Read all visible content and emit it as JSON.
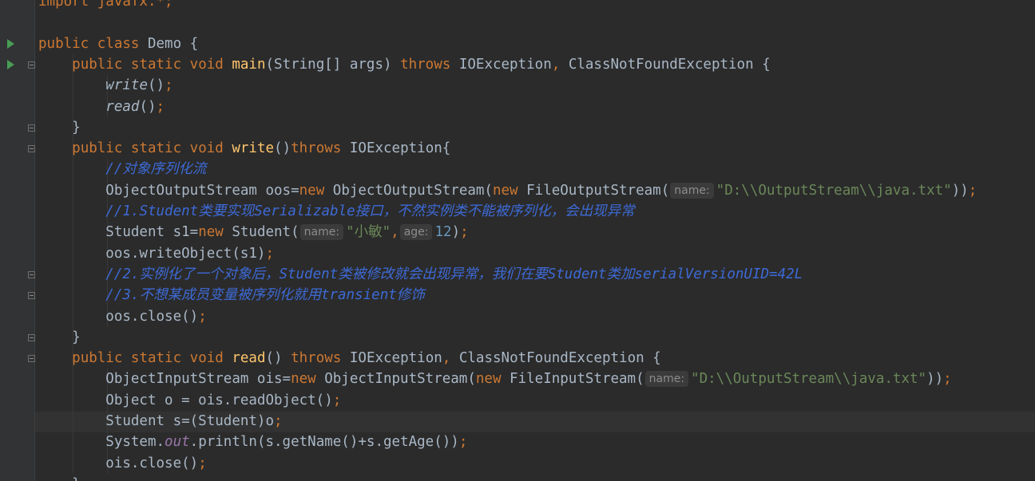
{
  "code_lines": [
    {
      "tokens": [
        {
          "t": "import javafx.*;",
          "c": "kw"
        }
      ]
    },
    {
      "tokens": []
    },
    {
      "tokens": [
        {
          "t": "public class ",
          "c": "kw"
        },
        {
          "t": "Demo {"
        }
      ]
    },
    {
      "tokens": [
        {
          "t": "    "
        },
        {
          "t": "public static void ",
          "c": "kw"
        },
        {
          "t": "main",
          "c": "fn"
        },
        {
          "t": "(String[] args) "
        },
        {
          "t": "throws ",
          "c": "kw"
        },
        {
          "t": "IOException"
        },
        {
          "t": ", ",
          "c": "punc"
        },
        {
          "t": "ClassNotFoundException {"
        }
      ]
    },
    {
      "tokens": [
        {
          "t": "        "
        },
        {
          "t": "write",
          "c": "it"
        },
        {
          "t": "()"
        },
        {
          "t": ";",
          "c": "punc"
        }
      ]
    },
    {
      "tokens": [
        {
          "t": "        "
        },
        {
          "t": "read",
          "c": "it"
        },
        {
          "t": "()"
        },
        {
          "t": ";",
          "c": "punc"
        }
      ]
    },
    {
      "tokens": [
        {
          "t": "    }"
        }
      ]
    },
    {
      "tokens": [
        {
          "t": "    "
        },
        {
          "t": "public static void ",
          "c": "kw"
        },
        {
          "t": "write",
          "c": "fn"
        },
        {
          "t": "()"
        },
        {
          "t": "throws ",
          "c": "kw"
        },
        {
          "t": "IOException{"
        }
      ]
    },
    {
      "tokens": [
        {
          "t": "        "
        },
        {
          "t": "//对象序列化流",
          "c": "cmt"
        }
      ]
    },
    {
      "tokens": [
        {
          "t": "        ObjectOutputStream oos="
        },
        {
          "t": "new ",
          "c": "kw"
        },
        {
          "t": "ObjectOutputStream("
        },
        {
          "t": "new ",
          "c": "kw"
        },
        {
          "t": "FileOutputStream("
        },
        {
          "t": "name:",
          "c": "hint"
        },
        {
          "t": "\"D:\\\\OutputStream\\\\java.txt\"",
          "c": "str"
        },
        {
          "t": "))"
        },
        {
          "t": ";",
          "c": "punc"
        }
      ]
    },
    {
      "tokens": [
        {
          "t": "        "
        },
        {
          "t": "//1.Student类要实现Serializable接口，不然实例类不能被序列化，会出现异常",
          "c": "cmt"
        }
      ]
    },
    {
      "tokens": [
        {
          "t": "        Student s1="
        },
        {
          "t": "new ",
          "c": "kw"
        },
        {
          "t": "Student("
        },
        {
          "t": "name:",
          "c": "hint"
        },
        {
          "t": "\"小敏\"",
          "c": "str"
        },
        {
          "t": ",",
          "c": "punc"
        },
        {
          "t": "age:",
          "c": "hint"
        },
        {
          "t": "12",
          "c": "num"
        },
        {
          "t": ")"
        },
        {
          "t": ";",
          "c": "punc"
        }
      ]
    },
    {
      "tokens": [
        {
          "t": "        oos.writeObject(s1)"
        },
        {
          "t": ";",
          "c": "punc"
        }
      ]
    },
    {
      "tokens": [
        {
          "t": "        "
        },
        {
          "t": "//2.实例化了一个对象后，Student类被修改就会出现异常，我们在要Student类加serialVersionUID=42L",
          "c": "cmt"
        }
      ]
    },
    {
      "tokens": [
        {
          "t": "        "
        },
        {
          "t": "//3.不想某成员变量被序列化就用transient修饰",
          "c": "cmt"
        }
      ]
    },
    {
      "tokens": [
        {
          "t": "        oos.close()"
        },
        {
          "t": ";",
          "c": "punc"
        }
      ]
    },
    {
      "tokens": [
        {
          "t": "    }"
        }
      ]
    },
    {
      "tokens": [
        {
          "t": "    "
        },
        {
          "t": "public static void ",
          "c": "kw"
        },
        {
          "t": "read",
          "c": "fn"
        },
        {
          "t": "() "
        },
        {
          "t": "throws ",
          "c": "kw"
        },
        {
          "t": "IOException"
        },
        {
          "t": ", ",
          "c": "punc"
        },
        {
          "t": "ClassNotFoundException {"
        }
      ]
    },
    {
      "tokens": [
        {
          "t": "        ObjectInputStream ois="
        },
        {
          "t": "new ",
          "c": "kw"
        },
        {
          "t": "ObjectInputStream("
        },
        {
          "t": "new ",
          "c": "kw"
        },
        {
          "t": "FileInputStream("
        },
        {
          "t": "name:",
          "c": "hint"
        },
        {
          "t": "\"D:\\\\OutputStream\\\\java.txt\"",
          "c": "str"
        },
        {
          "t": "))"
        },
        {
          "t": ";",
          "c": "punc"
        }
      ]
    },
    {
      "tokens": [
        {
          "t": "        Object o = ois.readObject()"
        },
        {
          "t": ";",
          "c": "punc"
        }
      ]
    },
    {
      "tokens": [
        {
          "t": "        Student s=(Student)o"
        },
        {
          "t": ";",
          "c": "punc"
        }
      ]
    },
    {
      "tokens": [
        {
          "t": "        System."
        },
        {
          "t": "out",
          "c": "fld"
        },
        {
          "t": ".println(s.getName()+s.getAge())"
        },
        {
          "t": ";",
          "c": "punc"
        }
      ]
    },
    {
      "tokens": [
        {
          "t": "        ois.close()"
        },
        {
          "t": ";",
          "c": "punc"
        }
      ]
    },
    {
      "tokens": [
        {
          "t": "    }"
        }
      ]
    }
  ],
  "current_line_index": 20,
  "run_icon_lines": [
    2,
    3
  ],
  "fold_icon_lines": [
    3,
    6,
    7,
    13,
    14,
    16,
    17,
    23
  ],
  "icons": {
    "run": "run-gutter-icon",
    "fold": "fold-marker-icon"
  },
  "colors": {
    "background": "#2b2b2b",
    "gutter": "#313335",
    "keyword": "#cc7832",
    "method": "#ffc66d",
    "string": "#6a8759",
    "number": "#6897bb",
    "comment": "#3d6ad6",
    "text": "#a9b7c6"
  }
}
